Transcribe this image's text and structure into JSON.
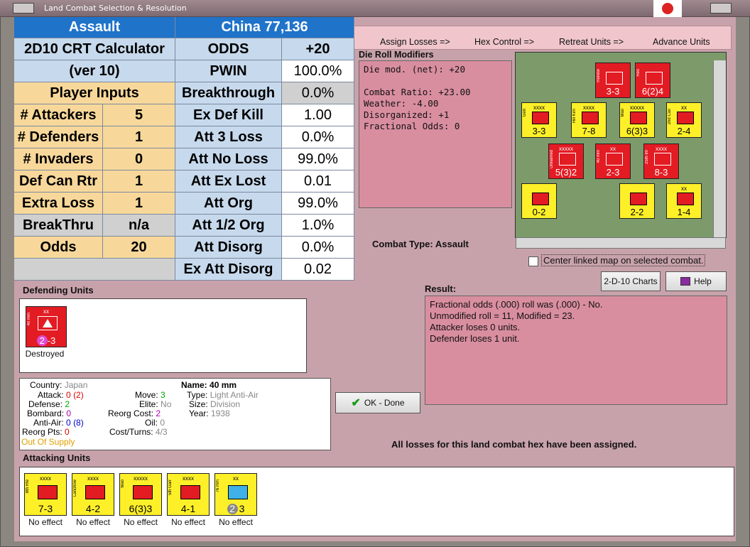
{
  "window": {
    "title": "Land Combat Selection & Resolution"
  },
  "toolbar": {
    "assign_losses": "Assign Losses =>",
    "hex_control": "Hex Control =>",
    "retreat_units": "Retreat Units =>",
    "advance_units": "Advance Units"
  },
  "crt": {
    "header_left": "Assault",
    "header_right": "China 77,136",
    "calc_title_1": "2D10 CRT Calculator",
    "calc_title_2": "(ver 10)",
    "player_inputs": "Player Inputs",
    "inputs": [
      {
        "label": "# Attackers",
        "value": "5"
      },
      {
        "label": "# Defenders",
        "value": "1"
      },
      {
        "label": "# Invaders",
        "value": "0"
      },
      {
        "label": "Def Can Rtr",
        "value": "1"
      },
      {
        "label": "Extra Loss",
        "value": "1"
      },
      {
        "label": "BreakThru",
        "value": "n/a"
      },
      {
        "label": "Odds",
        "value": "20"
      }
    ],
    "outputs": [
      {
        "label": "ODDS",
        "value": "+20"
      },
      {
        "label": "PWIN",
        "value": "100.0%"
      },
      {
        "label": "Breakthrough",
        "value": "0.0%"
      },
      {
        "label": "Ex Def Kill",
        "value": "1.00"
      },
      {
        "label": "Att 3 Loss",
        "value": "0.0%"
      },
      {
        "label": "Att No Loss",
        "value": "99.0%"
      },
      {
        "label": "Att Ex Lost",
        "value": "0.01"
      },
      {
        "label": "Att Org",
        "value": "99.0%"
      },
      {
        "label": "Att 1/2 Org",
        "value": "1.0%"
      },
      {
        "label": "Att Disorg",
        "value": "0.0%"
      },
      {
        "label": "Ex Att Disorg",
        "value": "0.02"
      }
    ]
  },
  "die_roll": {
    "title": "Die Roll Modifiers",
    "lines": [
      "Die mod. (net): +20",
      "",
      "Combat Ratio: +23.00",
      "Weather: -4.00",
      "Disorganized: +1",
      "Fractional Odds: 0"
    ]
  },
  "map": {
    "counters": [
      {
        "color": "red",
        "top": "",
        "side": "Renew",
        "value": "3-3"
      },
      {
        "color": "red",
        "top": "",
        "side": "Res",
        "value": "6(2)4"
      },
      {
        "color": "yellow",
        "top": "xxxx",
        "side": "Gen",
        "value": "3-3"
      },
      {
        "color": "yellow",
        "top": "xxxx",
        "side": "Hill Kim",
        "value": "7-8"
      },
      {
        "color": "yellow",
        "top": "xxxxx",
        "side": "Mao",
        "value": "6(3)3"
      },
      {
        "color": "yellow",
        "top": "xx",
        "side": "2nd Cav",
        "value": "2-4"
      },
      {
        "color": "red",
        "top": "xxxxx",
        "side": "Unnamed",
        "value": "5(3)2"
      },
      {
        "color": "red",
        "top": "xx",
        "side": "40 mm",
        "value": "2-3"
      },
      {
        "color": "red",
        "top": "xxxx",
        "side": "25th Inf",
        "value": "8-3"
      },
      {
        "color": "yellow",
        "top": "",
        "side": "",
        "value": "0-2"
      },
      {
        "color": "yellow",
        "top": "",
        "side": "",
        "value": "2-2"
      },
      {
        "color": "yellow",
        "top": "xx",
        "side": "",
        "value": "1-4"
      }
    ]
  },
  "combat_type": {
    "label": "Combat Type:",
    "value": "Assault"
  },
  "center_map": {
    "label": "Center linked map on selected combat."
  },
  "buttons": {
    "charts": "2-D-10 Charts",
    "help": "Help",
    "ok": "OK - Done"
  },
  "result": {
    "title": "Result:",
    "lines": [
      "Fractional odds (.000) roll was (.000)  -  No.",
      "Unmodified roll = 11, Modified = 23.",
      "Attacker loses 0 units.",
      "Defender loses 1 unit."
    ]
  },
  "defending": {
    "title": "Defending Units",
    "unit": {
      "top": "xx",
      "side": "40 mm",
      "value_circle": "2",
      "value_rest": "-3",
      "status": "Destroyed"
    }
  },
  "unit_info": {
    "country_label": "Country:",
    "country": "Japan",
    "attack_label": "Attack:",
    "attack": "0",
    "attack_paren": "(2)",
    "defense_label": "Defense:",
    "defense": "2",
    "bombard_label": "Bombard:",
    "bombard": "0",
    "antiair_label": "Anti-Air:",
    "antiair": "0",
    "antiair_paren": "(8)",
    "reorg_pts_label": "Reorg Pts:",
    "reorg_pts": "0",
    "supply": "Out Of Supply",
    "move_label": "Move:",
    "move": "3",
    "elite_label": "Elite:",
    "elite": "No",
    "reorg_cost_label": "Reorg Cost:",
    "reorg_cost": "2",
    "oil_label": "Oil:",
    "oil": "0",
    "cost_turns_label": "Cost/Turns:",
    "cost_turns": "4/3",
    "name_label": "Name:",
    "name": "40 mm",
    "type_label": "Type:",
    "type": "Light Anti-Air",
    "size_label": "Size:",
    "size": "Division",
    "year_label": "Year:",
    "year": "1938"
  },
  "losses_msg": "All losses for this land combat hex have been assigned.",
  "attacking": {
    "title": "Attacking Units",
    "units": [
      {
        "top": "xxxx",
        "side": "8th Rte",
        "value": "7-3",
        "status": "No effect",
        "sym": "red"
      },
      {
        "top": "xxxx",
        "side": "Lanchow",
        "value": "4-2",
        "status": "No effect",
        "sym": "red"
      },
      {
        "top": "xxxxx",
        "side": "Mao",
        "value": "6(3)3",
        "status": "No effect",
        "sym": "red"
      },
      {
        "top": "xxxx",
        "side": "5th Garr",
        "value": "4-1",
        "status": "No effect",
        "sym": "red"
      },
      {
        "top": "xx",
        "side": "76 mm",
        "value": "3",
        "value_circle": "2",
        "status": "No effect",
        "sym": "blue"
      }
    ]
  },
  "colors": {
    "crt_header": "#1f73c9",
    "crt_light_blue": "#c7d9ec",
    "crt_tan": "#f8d89a",
    "client_pink": "#c8a2aa",
    "result_pink": "#d98ea0"
  }
}
